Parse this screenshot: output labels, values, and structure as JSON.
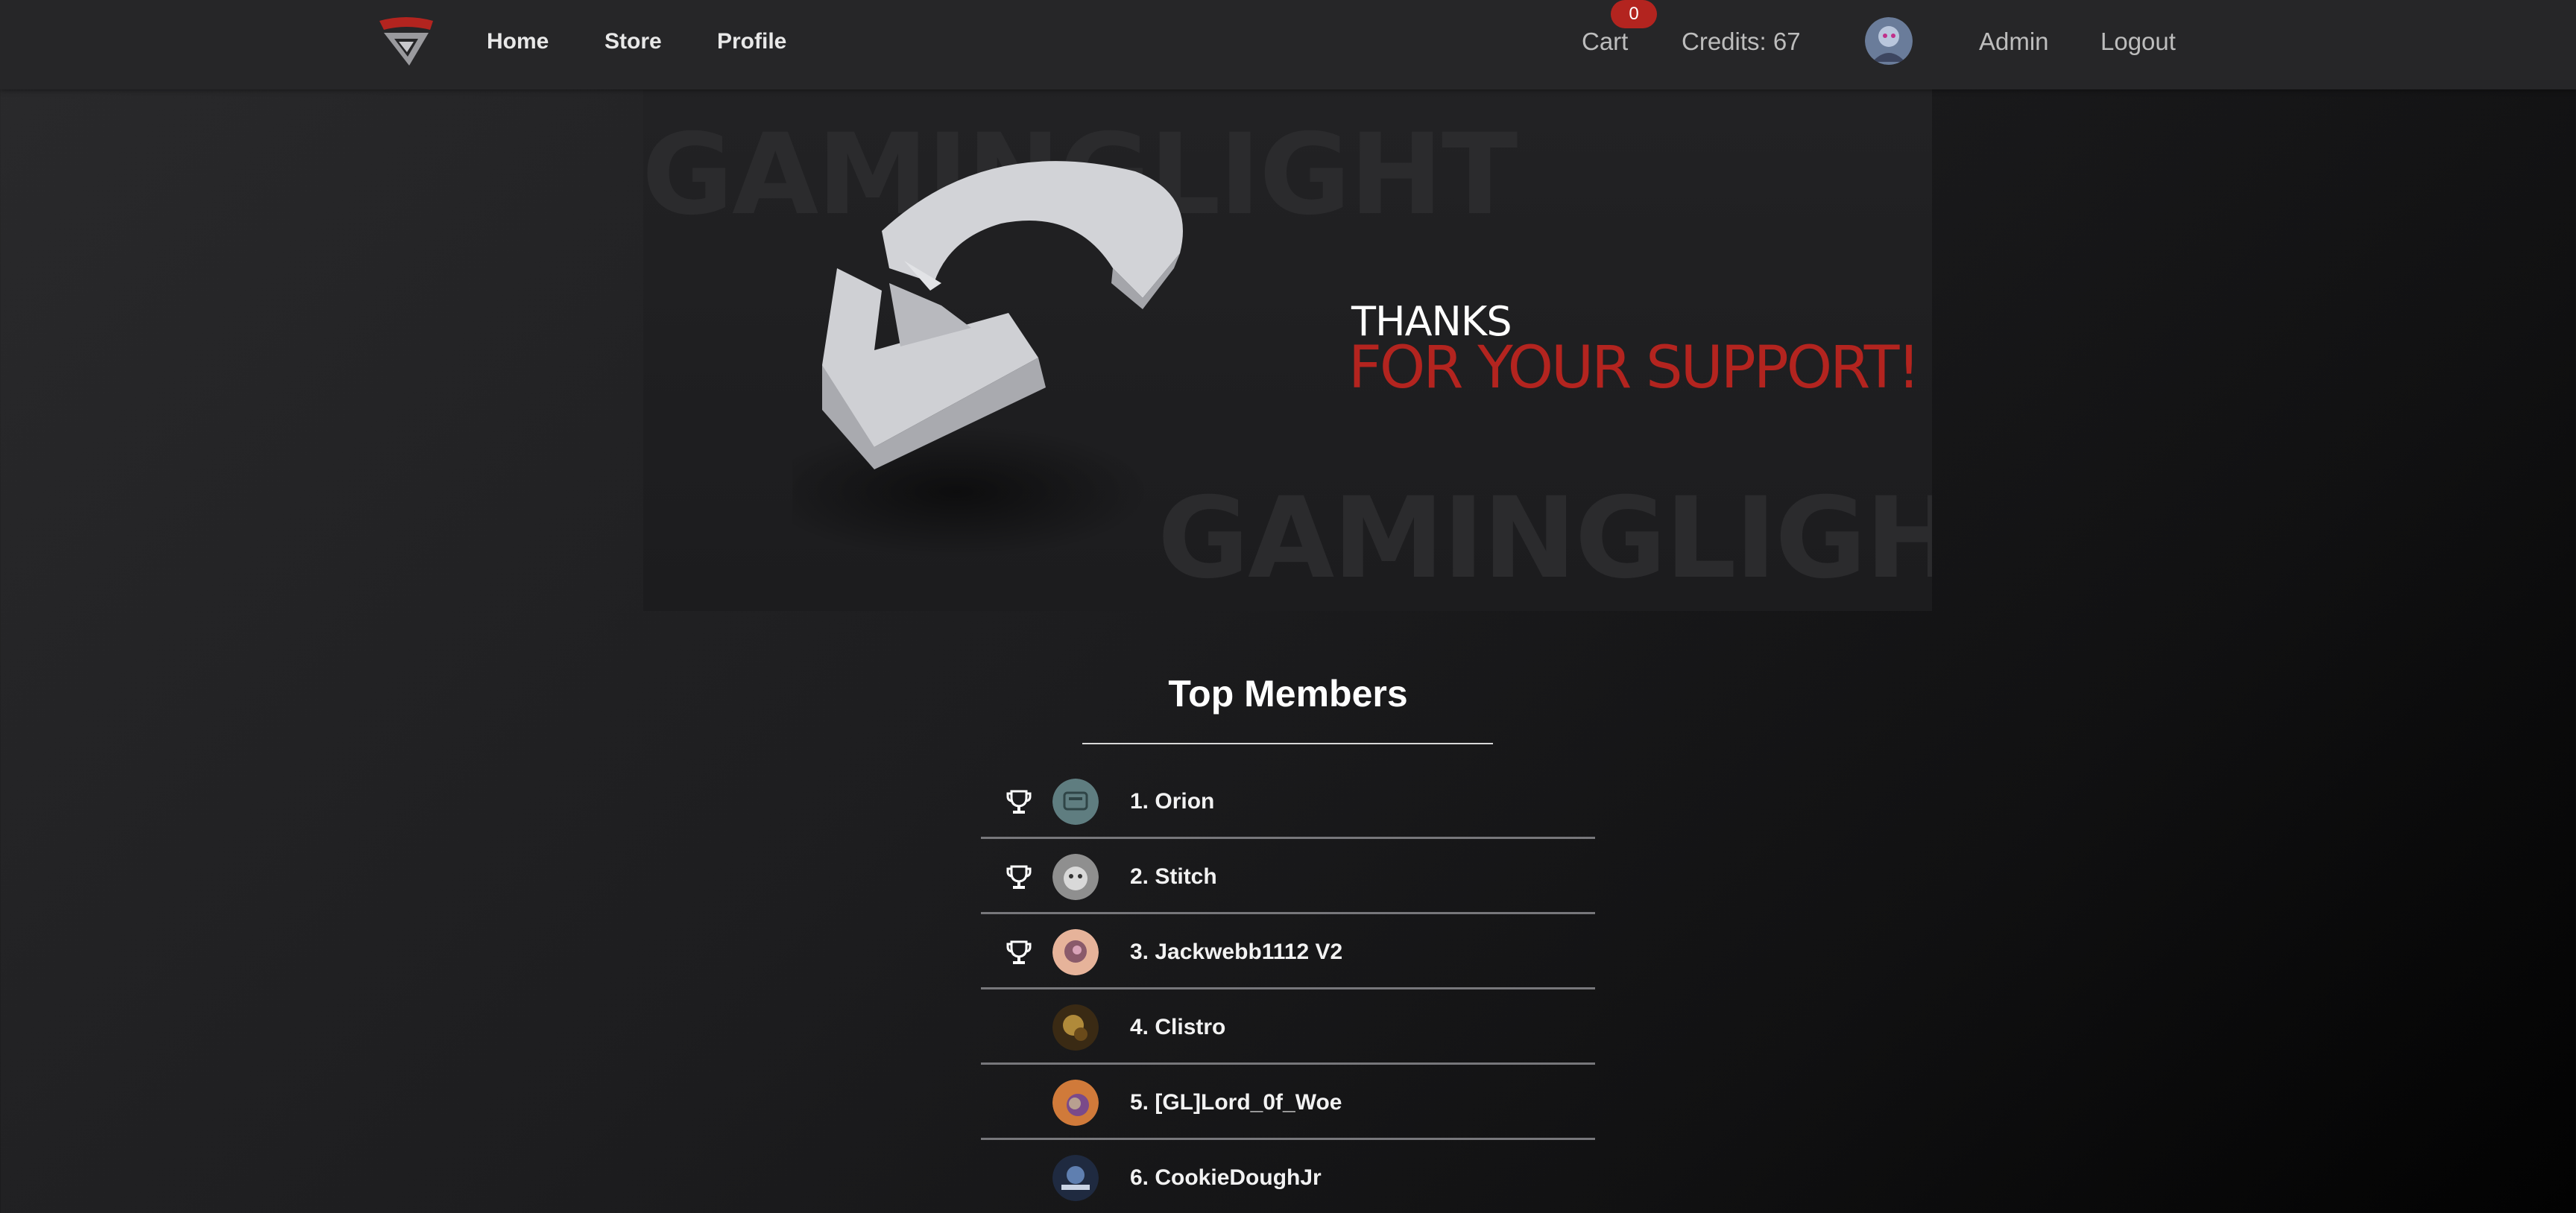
{
  "navbar": {
    "logo_icon": "gaminglight-logo-icon",
    "links": [
      "Home",
      "Store",
      "Profile"
    ],
    "cart_label": "Cart",
    "cart_count": "0",
    "credits": "Credits: 67",
    "avatar_icon": "user-avatar",
    "admin_label": "Admin",
    "logout_label": "Logout"
  },
  "hero": {
    "watermark_top": "GAMINGLIGHT",
    "watermark_bottom": "GAMINGLIGHT",
    "thanks": "THANKS",
    "support": "FOR YOUR SUPPORT!",
    "logo_icon": "gaminglight-3d-logo"
  },
  "top_members": {
    "title": "Top Members",
    "trophy_icon": "trophy-icon",
    "members": [
      {
        "name": "1. Orion",
        "trophy": true,
        "avatar_color": "#5f7d80"
      },
      {
        "name": "2. Stitch",
        "trophy": true,
        "avatar_color": "#9a9a9a"
      },
      {
        "name": "3. Jackwebb1112 V2",
        "trophy": true,
        "avatar_color": "#c88d74"
      },
      {
        "name": "4. Clistro",
        "trophy": false,
        "avatar_color": "#7a5a2a"
      },
      {
        "name": "5. [GL]Lord_0f_Woe",
        "trophy": false,
        "avatar_color": "#a0663a"
      },
      {
        "name": "6. CookieDoughJr",
        "trophy": false,
        "avatar_color": "#27354e"
      }
    ]
  },
  "colors": {
    "accent": "#b3241f",
    "navbar_bg": "#262628",
    "page_bg": "#1d1d1f"
  }
}
